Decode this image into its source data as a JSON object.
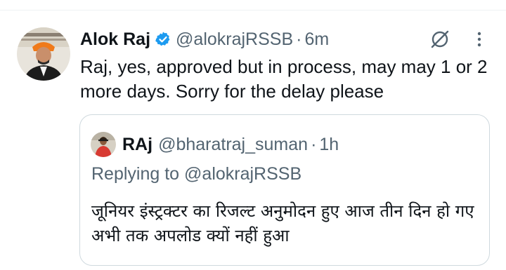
{
  "tweet": {
    "display_name": "Alok Raj",
    "handle": "@alokrajRSSB",
    "separator": "·",
    "time": "6m",
    "text": "Raj, yes, approved but in process, may may 1 or 2 more days. Sorry for the delay please",
    "icons": {
      "verified": "verified-badge-icon",
      "grok": "grok-icon",
      "more": "more-icon"
    }
  },
  "quoted_tweet": {
    "display_name": "RAj",
    "handle": "@bharatraj_suman",
    "separator": "·",
    "time": "1h",
    "reply_prefix": "Replying to",
    "reply_handle": "@alokrajRSSB",
    "text": "जूनियर इंस्ट्रक्टर का रिजल्ट अनुमोदन हुए आज तीन दिन हो गए अभी तक अपलोड क्यों नहीं हुआ"
  },
  "colors": {
    "text": "#0f1419",
    "secondary": "#536471",
    "verified": "#1d9bf0",
    "border": "#cfd9de",
    "divider": "#eff3f4"
  }
}
